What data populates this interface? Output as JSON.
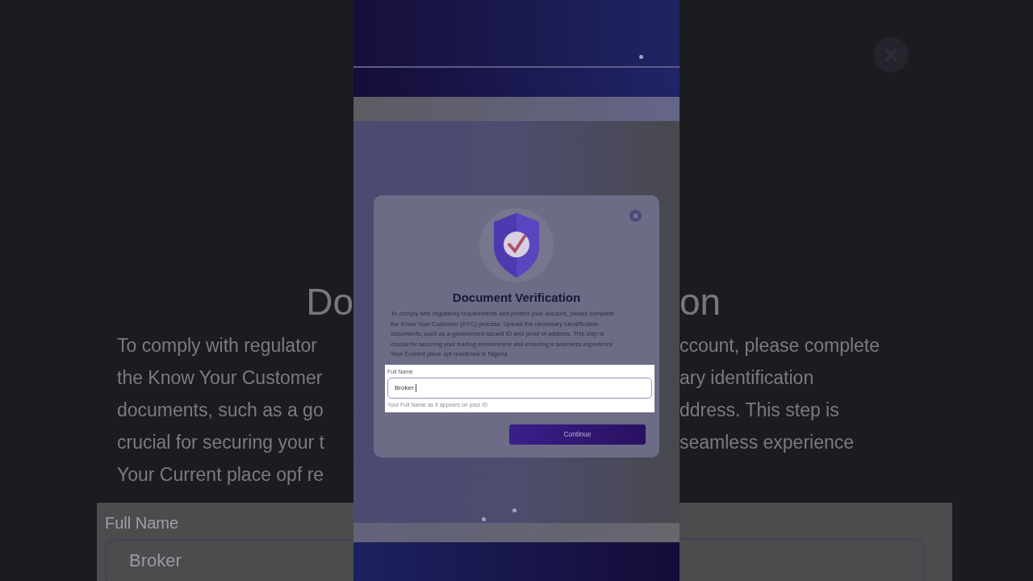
{
  "backdrop": {
    "title_left": "Do",
    "title_right": "on",
    "lines_left": [
      "To comply with regulator",
      "the Know Your Customer",
      "documents, such as a go",
      "crucial for securing your t",
      "Your Current place opf re"
    ],
    "lines_right": [
      "ccount, please complete",
      "ary identification",
      "ddress. This step is",
      "seamless experience"
    ],
    "field_label": "Full Name",
    "field_value": "Broker"
  },
  "modal": {
    "title": "Document Verification",
    "description_lines": [
      "To comply with regulatory requirements and protect your account, please complete",
      "the Know Your Customer (KYC) process. Upload the necessary identification",
      "documents, such as a government-issued ID and proof of address. This step is",
      "crucial for securing your trading environment and ensuring a seamless experience",
      "Your Current place opf residence is Nigeria"
    ],
    "field": {
      "label": "Full Name",
      "value": "Broker",
      "hint": "Your Full Name as it appears on your ID"
    },
    "button": "Continue"
  }
}
